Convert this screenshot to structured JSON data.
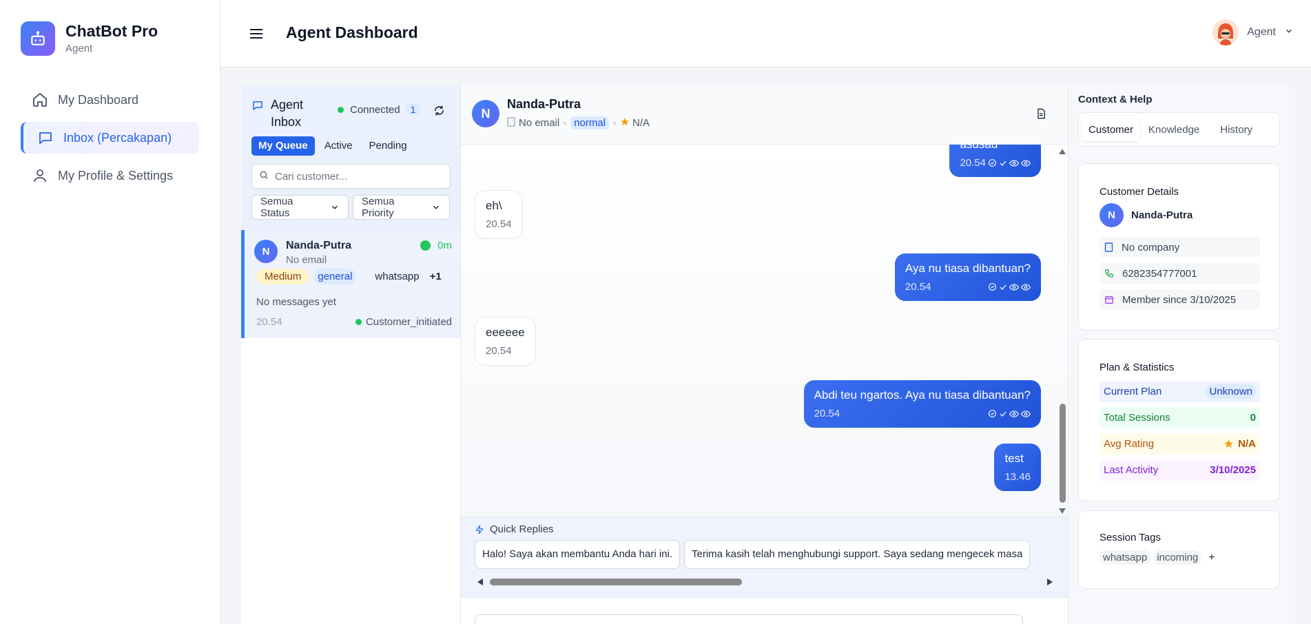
{
  "app": {
    "name": "ChatBot Pro",
    "role": "Agent"
  },
  "colors": {
    "accent": "#2563eb",
    "online": "#22c55e",
    "brand_gradient": [
      "#3b82f6",
      "#8b5cf6"
    ]
  },
  "sidebar": {
    "items": [
      {
        "label": "My Dashboard",
        "icon": "home-icon",
        "active": false
      },
      {
        "label": "Inbox (Percakapan)",
        "icon": "chat-icon",
        "active": true
      },
      {
        "label": "My Profile & Settings",
        "icon": "user-icon",
        "active": false
      }
    ]
  },
  "header": {
    "title": "Agent Dashboard",
    "user_label": "Agent"
  },
  "inbox": {
    "title": "Agent Inbox",
    "status": "Connected",
    "count": "1",
    "tabs": [
      "My Queue",
      "Active",
      "Pending"
    ],
    "active_tab": "My Queue",
    "search_placeholder": "Cari customer...",
    "filters": [
      "Semua Status",
      "Semua Priority"
    ],
    "conversations": [
      {
        "initial": "N",
        "name": "Nanda-Putra",
        "email": "No email",
        "online_duration": "0m",
        "priority": "Medium",
        "category": "general",
        "channel": "whatsapp",
        "more": "+1",
        "last_message": "No messages yet",
        "time": "20.54",
        "status": "Customer_initiated"
      }
    ]
  },
  "chat": {
    "initial": "N",
    "name": "Nanda-Putra",
    "email": "No email",
    "priority": "normal",
    "rating": "N/A",
    "messages": [
      {
        "direction": "out",
        "text": "asdsad",
        "time": "20.54"
      },
      {
        "direction": "in",
        "text": "eh\\",
        "time": "20.54"
      },
      {
        "direction": "out",
        "text": "Aya nu tiasa dibantuan?",
        "time": "20.54"
      },
      {
        "direction": "in",
        "text": "eeeeee",
        "time": "20.54"
      },
      {
        "direction": "out",
        "text": "Abdi teu ngartos. Aya nu tiasa dibantuan?",
        "time": "20.54"
      },
      {
        "direction": "out",
        "text": "test",
        "time": "13.46"
      }
    ],
    "quick_replies_title": "Quick Replies",
    "quick_replies": [
      "Halo! Saya akan membantu Anda hari ini.",
      "Terima kasih telah menghubungi support. Saya sedang mengecek masa"
    ]
  },
  "context": {
    "title": "Context & Help",
    "tabs": [
      "Customer",
      "Knowledge",
      "History"
    ],
    "active_tab": "Customer",
    "customer_details": {
      "title": "Customer Details",
      "initial": "N",
      "name": "Nanda-Putra",
      "company": "No company",
      "phone": "6282354777001",
      "member_since": "Member since 3/10/2025"
    },
    "plan_stats": {
      "title": "Plan & Statistics",
      "current_plan_label": "Current Plan",
      "current_plan": "Unknown",
      "total_sessions_label": "Total Sessions",
      "total_sessions": "0",
      "avg_rating_label": "Avg Rating",
      "avg_rating": "N/A",
      "last_activity_label": "Last Activity",
      "last_activity": "3/10/2025"
    },
    "session_tags": {
      "title": "Session Tags",
      "tags": [
        "whatsapp",
        "incoming"
      ],
      "add": "+"
    }
  }
}
